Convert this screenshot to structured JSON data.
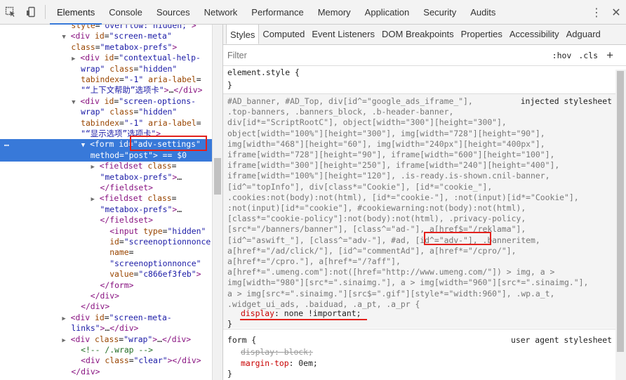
{
  "toolbar": {
    "tabs": [
      "Elements",
      "Console",
      "Sources",
      "Network",
      "Performance",
      "Memory",
      "Application",
      "Security",
      "Audits"
    ],
    "active_tab": "Elements"
  },
  "tree": {
    "lines": [
      {
        "indent": "    ",
        "html": "<span class='attr'>style</span>=<span class='val'>\"overflow: hidden;\"</span><span class='tag'>&gt;</span>"
      },
      {
        "indent": "    ",
        "tri": "▼",
        "html": "<span class='tag'>&lt;div</span> <span class='attr'>id</span>=<span class='val'>\"screen-meta\"</span>"
      },
      {
        "indent": "    ",
        "html": "<span class='attr'>class</span>=<span class='val'>\"metabox-prefs\"</span><span class='tag'>&gt;</span>"
      },
      {
        "indent": "      ",
        "tri": "▶",
        "html": "<span class='tag'>&lt;div</span> <span class='attr'>id</span>=<span class='val'>\"contextual-help-</span>"
      },
      {
        "indent": "      ",
        "html": "<span class='val'>wrap\"</span> <span class='attr'>class</span>=<span class='val'>\"hidden\"</span>"
      },
      {
        "indent": "      ",
        "html": "<span class='attr'>tabindex</span>=<span class='val'>\"-1\"</span> <span class='attr'>aria-label</span>="
      },
      {
        "indent": "      ",
        "html": "<span class='val'>\"“上下文帮助”选项卡\"</span><span class='tag'>&gt;</span>…<span class='tag'>&lt;/div&gt;</span>"
      },
      {
        "indent": "      ",
        "tri": "▼",
        "html": "<span class='tag'>&lt;div</span> <span class='attr'>id</span>=<span class='val'>\"screen-options-</span>"
      },
      {
        "indent": "      ",
        "html": "<span class='val'>wrap\"</span> <span class='attr'>class</span>=<span class='val'>\"hidden\"</span>"
      },
      {
        "indent": "      ",
        "html": "<span class='attr'>tabindex</span>=<span class='val'>\"-1\"</span> <span class='attr'>aria-label</span>="
      },
      {
        "indent": "      ",
        "html": "<span class='val'>\"“显示选项”选项卡\"</span><span class='tag'>&gt;</span>"
      },
      {
        "indent": "        ",
        "tri": "▼",
        "html": "<span class='tag'>&lt;form</span> <span class='attr'>id</span>=<span class='val'>\"adv-settings\"</span>",
        "selected": true
      },
      {
        "indent": "        ",
        "html": "<span class='attr'>method</span>=<span class='val'>\"post\"</span><span class='tag'>&gt;</span> == $0",
        "selected": true
      },
      {
        "indent": "          ",
        "tri": "▶",
        "html": "<span class='tag'>&lt;fieldset</span> <span class='attr'>class</span>="
      },
      {
        "indent": "          ",
        "html": "<span class='val'>\"metabox-prefs\"</span><span class='tag'>&gt;</span>…"
      },
      {
        "indent": "          ",
        "html": "<span class='tag'>&lt;/fieldset&gt;</span>"
      },
      {
        "indent": "          ",
        "tri": "▶",
        "html": "<span class='tag'>&lt;fieldset</span> <span class='attr'>class</span>="
      },
      {
        "indent": "          ",
        "html": "<span class='val'>\"metabox-prefs\"</span><span class='tag'>&gt;</span>…"
      },
      {
        "indent": "          ",
        "html": "<span class='tag'>&lt;/fieldset&gt;</span>"
      },
      {
        "indent": "            ",
        "html": "<span class='tag'>&lt;input</span> <span class='attr'>type</span>=<span class='val'>\"hidden\"</span>"
      },
      {
        "indent": "            ",
        "html": "<span class='attr'>id</span>=<span class='val'>\"screenoptionnonce\"</span>"
      },
      {
        "indent": "            ",
        "html": "<span class='attr'>name</span>="
      },
      {
        "indent": "            ",
        "html": "<span class='val'>\"screenoptionnonce\"</span>"
      },
      {
        "indent": "            ",
        "html": "<span class='attr'>value</span>=<span class='val'>\"c866ef3feb\"</span><span class='tag'>&gt;</span>"
      },
      {
        "indent": "          ",
        "html": "<span class='tag'>&lt;/form&gt;</span>"
      },
      {
        "indent": "        ",
        "html": "<span class='tag'>&lt;/div&gt;</span>"
      },
      {
        "indent": "      ",
        "html": "<span class='tag'>&lt;/div&gt;</span>"
      },
      {
        "indent": "    ",
        "tri": "▶",
        "html": "<span class='tag'>&lt;div</span> <span class='attr'>id</span>=<span class='val'>\"screen-meta-</span>"
      },
      {
        "indent": "    ",
        "html": "<span class='val'>links\"</span><span class='tag'>&gt;</span>…<span class='tag'>&lt;/div&gt;</span>"
      },
      {
        "indent": "    ",
        "tri": "▶",
        "html": "<span class='tag'>&lt;div</span> <span class='attr'>class</span>=<span class='val'>\"wrap\"</span><span class='tag'>&gt;</span>…<span class='tag'>&lt;/div&gt;</span>"
      },
      {
        "indent": "      ",
        "html": "<span class='cmt'>&lt;!-- /.wrap --&gt;</span>"
      },
      {
        "indent": "      ",
        "html": "<span class='tag'>&lt;div</span> <span class='attr'>class</span>=<span class='val'>\"clear\"</span><span class='tag'>&gt;&lt;/div&gt;</span>"
      },
      {
        "indent": "    ",
        "html": "<span class='tag'>&lt;/div&gt;</span>"
      }
    ],
    "selected_dots": "…"
  },
  "styles": {
    "subtabs": [
      "Styles",
      "Computed",
      "Event Listeners",
      "DOM Breakpoints",
      "Properties",
      "Accessibility",
      "Adguard"
    ],
    "active_subtab": "Styles",
    "filter_placeholder": "Filter",
    "hov": ":hov",
    "cls": ".cls",
    "plus": "+",
    "element_style": "element.style {",
    "close_brace": "}",
    "injected_label": "injected stylesheet",
    "injected_selector_lines": [
      "#AD_banner, #AD_Top, div[id^=\"google_ads_iframe_\"],",
      ".top-banners, .banners_block, .b-header-banner,",
      "div[id*=\"ScriptRootC\"], object[width=\"300\"][height=\"300\"],",
      "object[width=\"100%\"][height=\"300\"], img[width=\"728\"][height=\"90\"],",
      "img[width=\"468\"][height=\"60\"], img[width=\"240px\"][height=\"400px\"],",
      "iframe[width=\"728\"][height=\"90\"], iframe[width=\"600\"][height=\"100\"],",
      "iframe[width=\"300\"][height=\"250\"], iframe[width=\"240\"][height=\"400\"],",
      "iframe[width=\"100%\"][height=\"120\"], .is-ready.is-shown.cnil-banner,",
      "[id^=\"topInfo\"], div[class*=\"Cookie\"], [id*=\"cookie_\"],",
      ".cookies:not(body):not(html), [id*=\"cookie-\"], :not(input)[id*=\"Cookie\"],",
      ":not(input)[id*=\"cookie\"], #cookiewarning:not(body):not(html),",
      "[class*=\"cookie-policy\"]:not(body):not(html), .privacy-policy,",
      "[src*=\"/banners/banner\"], [class^=\"ad-\"], a[href$=\"/reklama\"],",
      "[id^=\"aswift_\"], [class^=\"adv-\"], #ad, [id^=\"adv-\"], .banneritem,",
      "a[href*=\"/ad/click/\"], [id^=\"commentAd\"], a[href*=\"/cpro/\"],",
      "a[href*=\"/cpro.\"], a[href*=\"/?aff\"],",
      "a[href*=\".umeng.com\"]:not([href=\"http://www.umeng.com/\"]) > img, a >",
      "img[width=\"980\"][src*=\".sinaimg.\"], a > img[width=\"960\"][src*=\".sinaimg.\"],",
      "a > img[src*=\".sinaimg.\"][src$=\".gif\"][style*=\"width:960\"], .wp.a_t,",
      ".widget_ui_ads, .baiduad, .a_pt, .a_pr {"
    ],
    "injected_decl_prop": "display",
    "injected_decl_value": "none !important;",
    "ua_label": "user agent stylesheet",
    "form_selector": "form {",
    "ua_decl1_prop": "display",
    "ua_decl1_value": "block;",
    "ua_decl2_prop": "margin-top",
    "ua_decl2_value": "0em;"
  }
}
